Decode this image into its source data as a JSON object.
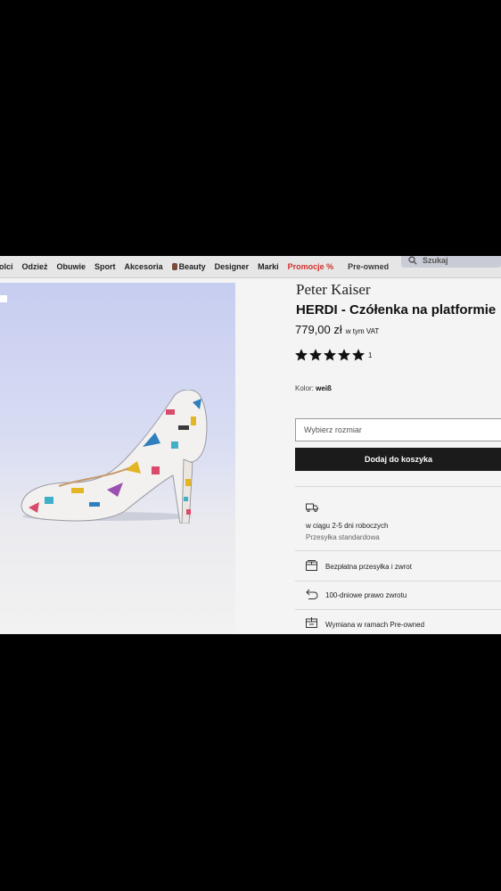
{
  "nav": {
    "items": [
      "olci",
      "Odzież",
      "Obuwie",
      "Sport",
      "Akcesoria",
      "Beauty",
      "Designer",
      "Marki",
      "Promocje %",
      "Pre-owned"
    ],
    "search_label": "Szukaj",
    "promo_color": "#d4312b"
  },
  "product": {
    "brand": "Peter Kaiser",
    "name": "HERDI - Czółenka na platformie",
    "price": "779,00 zł",
    "vat_note": "w tym VAT",
    "rating": 5,
    "rating_max": 5,
    "review_count": "1",
    "color_label": "Kolor:",
    "color_value": "weiß"
  },
  "purchase": {
    "size_placeholder": "Wybierz rozmiar",
    "add_to_cart": "Dodaj do koszyka"
  },
  "delivery": {
    "icon": "truck-icon",
    "time": "w ciągu 2-5 dni roboczych",
    "method": "Przesyłka standardowa"
  },
  "features": [
    {
      "icon": "box-icon",
      "text": "Bezpłatna przesyłka i zwrot"
    },
    {
      "icon": "return-arrow-icon",
      "text": "100-dniowe prawo zwrotu"
    },
    {
      "icon": "exchange-box-icon",
      "text": "Wymiana w ramach Pre-owned"
    }
  ]
}
